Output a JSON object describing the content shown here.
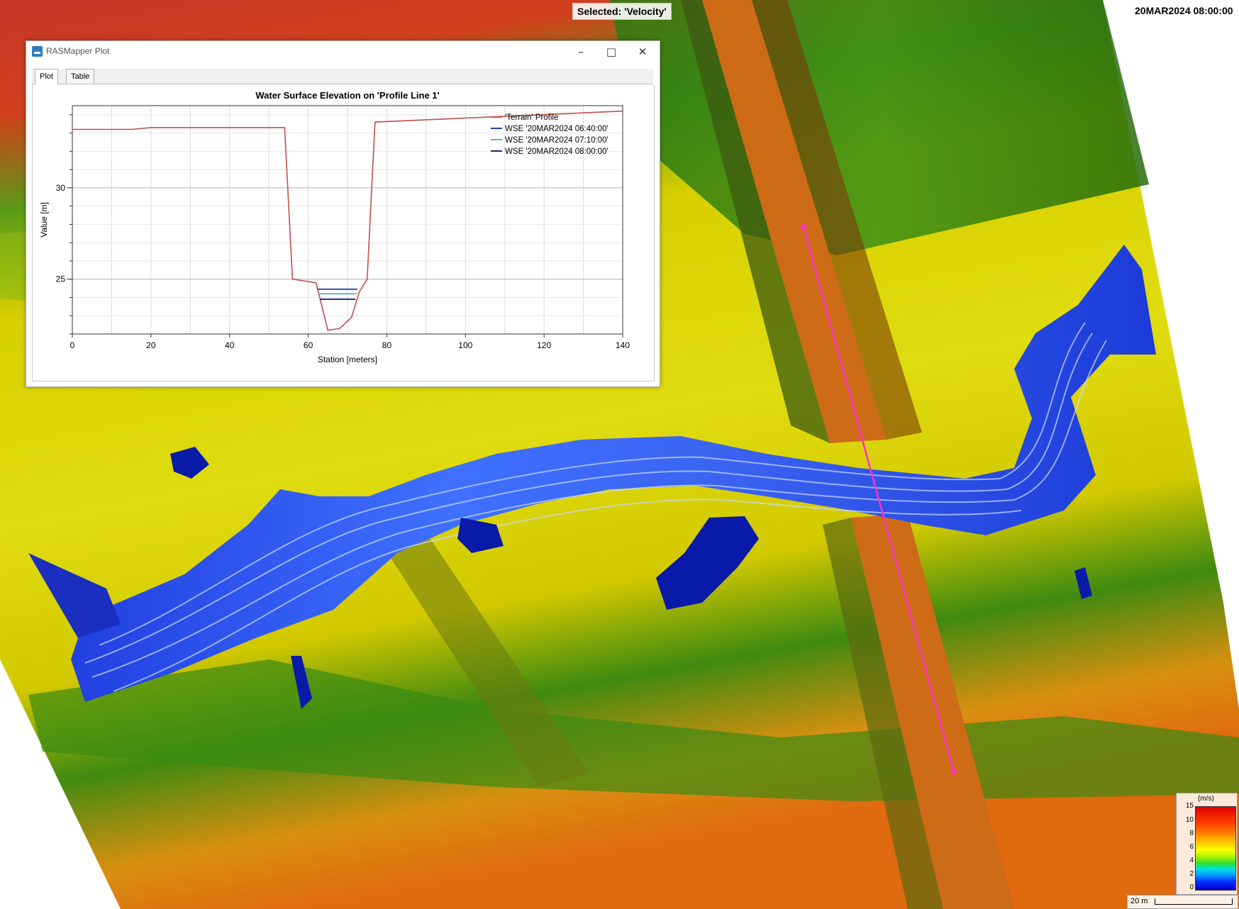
{
  "map": {
    "selected_label": "Selected: 'Velocity'",
    "timestamp": "20MAR2024 08:00:00",
    "legend": {
      "unit": "(m/s)",
      "ticks": [
        "15",
        "10",
        "8",
        "6",
        "4",
        "2",
        "0"
      ]
    },
    "scale": {
      "label": "20 m"
    }
  },
  "window": {
    "title": "RASMapper Plot",
    "tabs": [
      {
        "label": "Plot"
      },
      {
        "label": "Table"
      }
    ],
    "minimize_glyph": "–",
    "maximize_glyph": "□",
    "close_glyph": "✕"
  },
  "colors": {
    "terrain": "#c0504d",
    "wse_0640": "#1f3dbf",
    "wse_0710": "#6ea8c9",
    "wse_0800": "#1a237e"
  },
  "chart_data": {
    "type": "line",
    "title": "Water Surface Elevation on 'Profile Line 1'",
    "xlabel": "Station [meters]",
    "ylabel": "Value [m]",
    "xlim": [
      0,
      140
    ],
    "ylim": [
      22,
      34.5
    ],
    "xticks": [
      0,
      20,
      40,
      60,
      80,
      100,
      120,
      140
    ],
    "yticks": [
      25,
      30
    ],
    "grid": true,
    "legend_position": "top-right",
    "series": [
      {
        "name": "'Terrain' Profile",
        "color": "#c0504d",
        "x": [
          0,
          15,
          20,
          54,
          56,
          62,
          65,
          68,
          71,
          73,
          75,
          77,
          140
        ],
        "y": [
          33.2,
          33.2,
          33.3,
          33.3,
          25.0,
          24.8,
          22.2,
          22.3,
          22.9,
          24.3,
          25.0,
          33.6,
          34.2
        ]
      },
      {
        "name": "WSE '20MAR2024 06:40:00'",
        "color": "#1f3dbf",
        "x": [
          62.3,
          72.5
        ],
        "y": [
          24.45,
          24.45
        ]
      },
      {
        "name": "WSE '20MAR2024 07:10:00'",
        "color": "#6ea8c9",
        "x": [
          62.7,
          72.3
        ],
        "y": [
          24.2,
          24.2
        ]
      },
      {
        "name": "WSE '20MAR2024 08:00:00'",
        "color": "#1a237e",
        "x": [
          63.0,
          72.0
        ],
        "y": [
          23.9,
          23.9
        ]
      }
    ]
  }
}
